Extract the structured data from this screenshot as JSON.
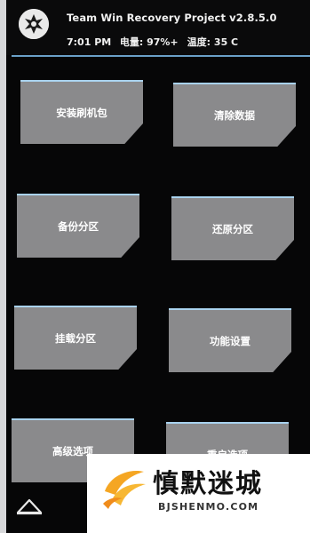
{
  "header": {
    "title": "Team Win Recovery Project  v2.8.5.0",
    "time": "7:01 PM",
    "battery": "电量: 97%+",
    "temperature": "温度: 35 C"
  },
  "buttons": [
    {
      "label": "安装刷机包"
    },
    {
      "label": "清除数据"
    },
    {
      "label": "备份分区"
    },
    {
      "label": "还原分区"
    },
    {
      "label": "挂载分区"
    },
    {
      "label": "功能设置"
    },
    {
      "label": "高级选项"
    },
    {
      "label": "重启选项"
    }
  ],
  "nav": {
    "home_icon": "home-icon"
  },
  "watermark": {
    "title": "慎默迷城",
    "subtitle": "BJSHENMO.COM"
  },
  "colors": {
    "background": "#060607",
    "button": "#8a8a8c",
    "button_border": "#a9d2ee",
    "divider": "#6aa0c8",
    "text": "#f0f0f0",
    "watermark_accent": "#f5a623"
  }
}
